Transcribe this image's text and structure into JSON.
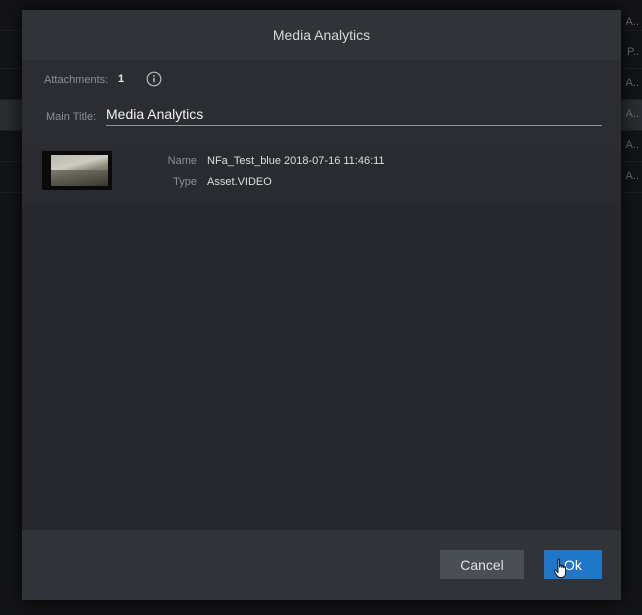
{
  "background": {
    "rows": [
      {
        "cell": "A.."
      },
      {
        "cell": "P.."
      },
      {
        "cell": "A.."
      },
      {
        "cell": "A.."
      },
      {
        "cell": "A.."
      },
      {
        "cell": "A.."
      }
    ]
  },
  "dialog": {
    "title": "Media Analytics",
    "attachments_label": "Attachments:",
    "attachments_count": "1",
    "info_icon": "info-circle-icon",
    "main_title_label": "Main Title:",
    "main_title_value": "Media Analytics",
    "attachment": {
      "name_label": "Name",
      "name_value": "NFa_Test_blue 2018-07-16 11:46:11",
      "type_label": "Type",
      "type_value": "Asset.VIDEO"
    },
    "cancel_label": "Cancel",
    "ok_label": "Ok"
  },
  "colors": {
    "accent": "#1f77c9",
    "dialog_bg": "#26282d",
    "header_bg": "#303338"
  }
}
